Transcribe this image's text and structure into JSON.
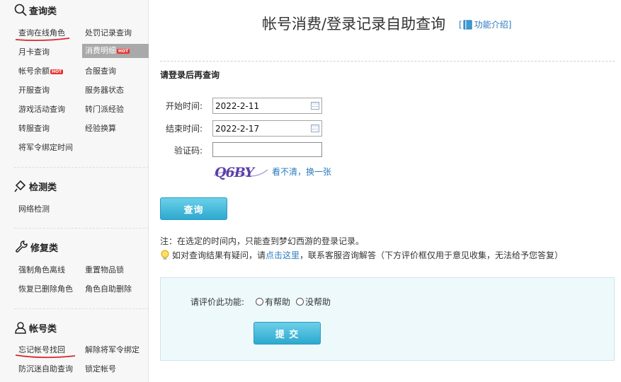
{
  "sidebar": {
    "sections": {
      "query": {
        "title": "查询类",
        "items": {
          "online_role": "查询在线角色",
          "penalty": "处罚记录查询",
          "monthly_card": "月卡查询",
          "consumption": "消费明细",
          "balance": "帐号余额",
          "merge_server": "合服查询",
          "open_server": "开服查询",
          "server_status": "服务器状态",
          "event_query": "游戏活动查询",
          "sect_transfer_exp": "转门派经验",
          "transfer_server": "转服查询",
          "exp_exchange": "经验换算",
          "general_bind_time": "将军令绑定时间"
        },
        "hot_badge": "HOT"
      },
      "detect": {
        "title": "检测类",
        "items": {
          "network": "网络检测"
        }
      },
      "repair": {
        "title": "修复类",
        "items": {
          "force_offline": "强制角色离线",
          "reset_item_lock": "重置物品锁",
          "restore_deleted": "恢复已删除角色",
          "self_delete": "角色自助删除"
        }
      },
      "account": {
        "title": "帐号类",
        "items": {
          "recover_account": "忘记帐号找回",
          "unbind_general": "解除将军令绑定",
          "anti_addiction": "防沉迷自助查询",
          "lock_account": "锁定帐号"
        }
      }
    }
  },
  "main": {
    "title": "帐号消费/登录记录自助查询",
    "intro_link": "功能介绍",
    "intro_open": "[",
    "intro_close": "]",
    "login_note": "请登录后再查询",
    "form": {
      "start_label": "开始时间:",
      "start_value": "2022-2-11",
      "end_label": "结束时间:",
      "end_value": "2022-2-17",
      "captcha_label": "验证码:",
      "captcha_text": "Q6BY",
      "refresh_text": "看不清，换一张",
      "query_button": "查询"
    },
    "notes": {
      "line1": "注：在选定的时间内，只能查到梦幻西游的登录记录。",
      "line2_before": "如对查询结果有疑问，请",
      "line2_link": "点击这里",
      "line2_after": "，联系客服咨询解答（下方评价框仅用于意见收集，无法给予您答复）"
    },
    "feedback": {
      "label": "请评价此功能:",
      "option_yes": "有帮助",
      "option_no": "没帮助",
      "submit": "提 交"
    }
  },
  "colors": {
    "accent_blue": "#2a7bbf",
    "button_blue": "#2da9cf",
    "hot_red": "#e8322b",
    "feedback_bg": "#eef9fc",
    "active_item_bg": "#a9a9a9",
    "underline_red": "#d9262b"
  }
}
